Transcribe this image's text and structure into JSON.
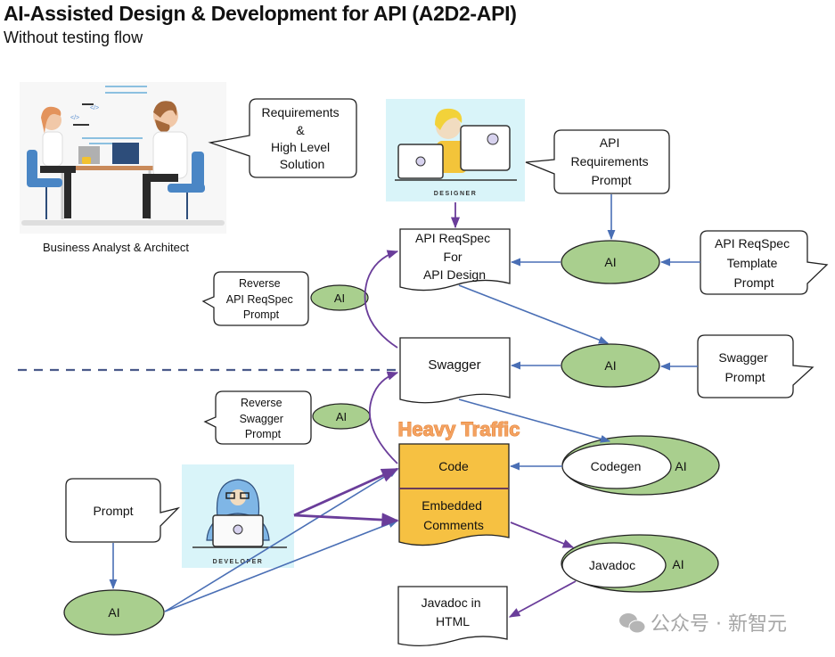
{
  "header": {
    "title": "AI-Assisted Design & Development for API (A2D2-API)",
    "subtitle": "Without testing flow"
  },
  "actors": {
    "business": {
      "caption": "Business Analyst & Architect"
    },
    "designer": {
      "caption": "DESIGNER"
    },
    "developer": {
      "caption": "DEVELOPER"
    }
  },
  "callouts": {
    "requirements": [
      "Requirements",
      "&",
      "High Level",
      "Solution"
    ],
    "api_requirements_prompt": [
      "API",
      "Requirements",
      "Prompt"
    ],
    "reqspec_template_prompt": [
      "API ReqSpec",
      "Template",
      "Prompt"
    ],
    "swagger_prompt": [
      "Swagger",
      "Prompt"
    ],
    "reverse_reqspec_prompt": [
      "Reverse",
      "API ReqSpec",
      "Prompt"
    ],
    "reverse_swagger_prompt": [
      "Reverse",
      "Swagger",
      "Prompt"
    ],
    "dev_prompt": [
      "Prompt"
    ]
  },
  "documents": {
    "reqspec": [
      "API ReqSpec",
      "For",
      "API Design"
    ],
    "swagger": [
      "Swagger"
    ],
    "code": "Code",
    "comments": [
      "Embedded",
      "Comments"
    ],
    "javadoc_html": [
      "Javadoc in",
      "HTML"
    ]
  },
  "ai_nodes": {
    "label": "AI",
    "codegen": "Codegen",
    "javadoc": "Javadoc"
  },
  "annotations": {
    "heavy_traffic": "Heavy Traffic",
    "watermark": "公众号 · 新智元"
  },
  "colors": {
    "ai_green": "#a9cf8e",
    "code_yellow": "#f6c142",
    "blue_arrow": "#4a6fb5",
    "purple_arrow": "#6a3d9a",
    "actor_bg": "#d9f4f9",
    "heavy_orange": "#f08a3c"
  }
}
